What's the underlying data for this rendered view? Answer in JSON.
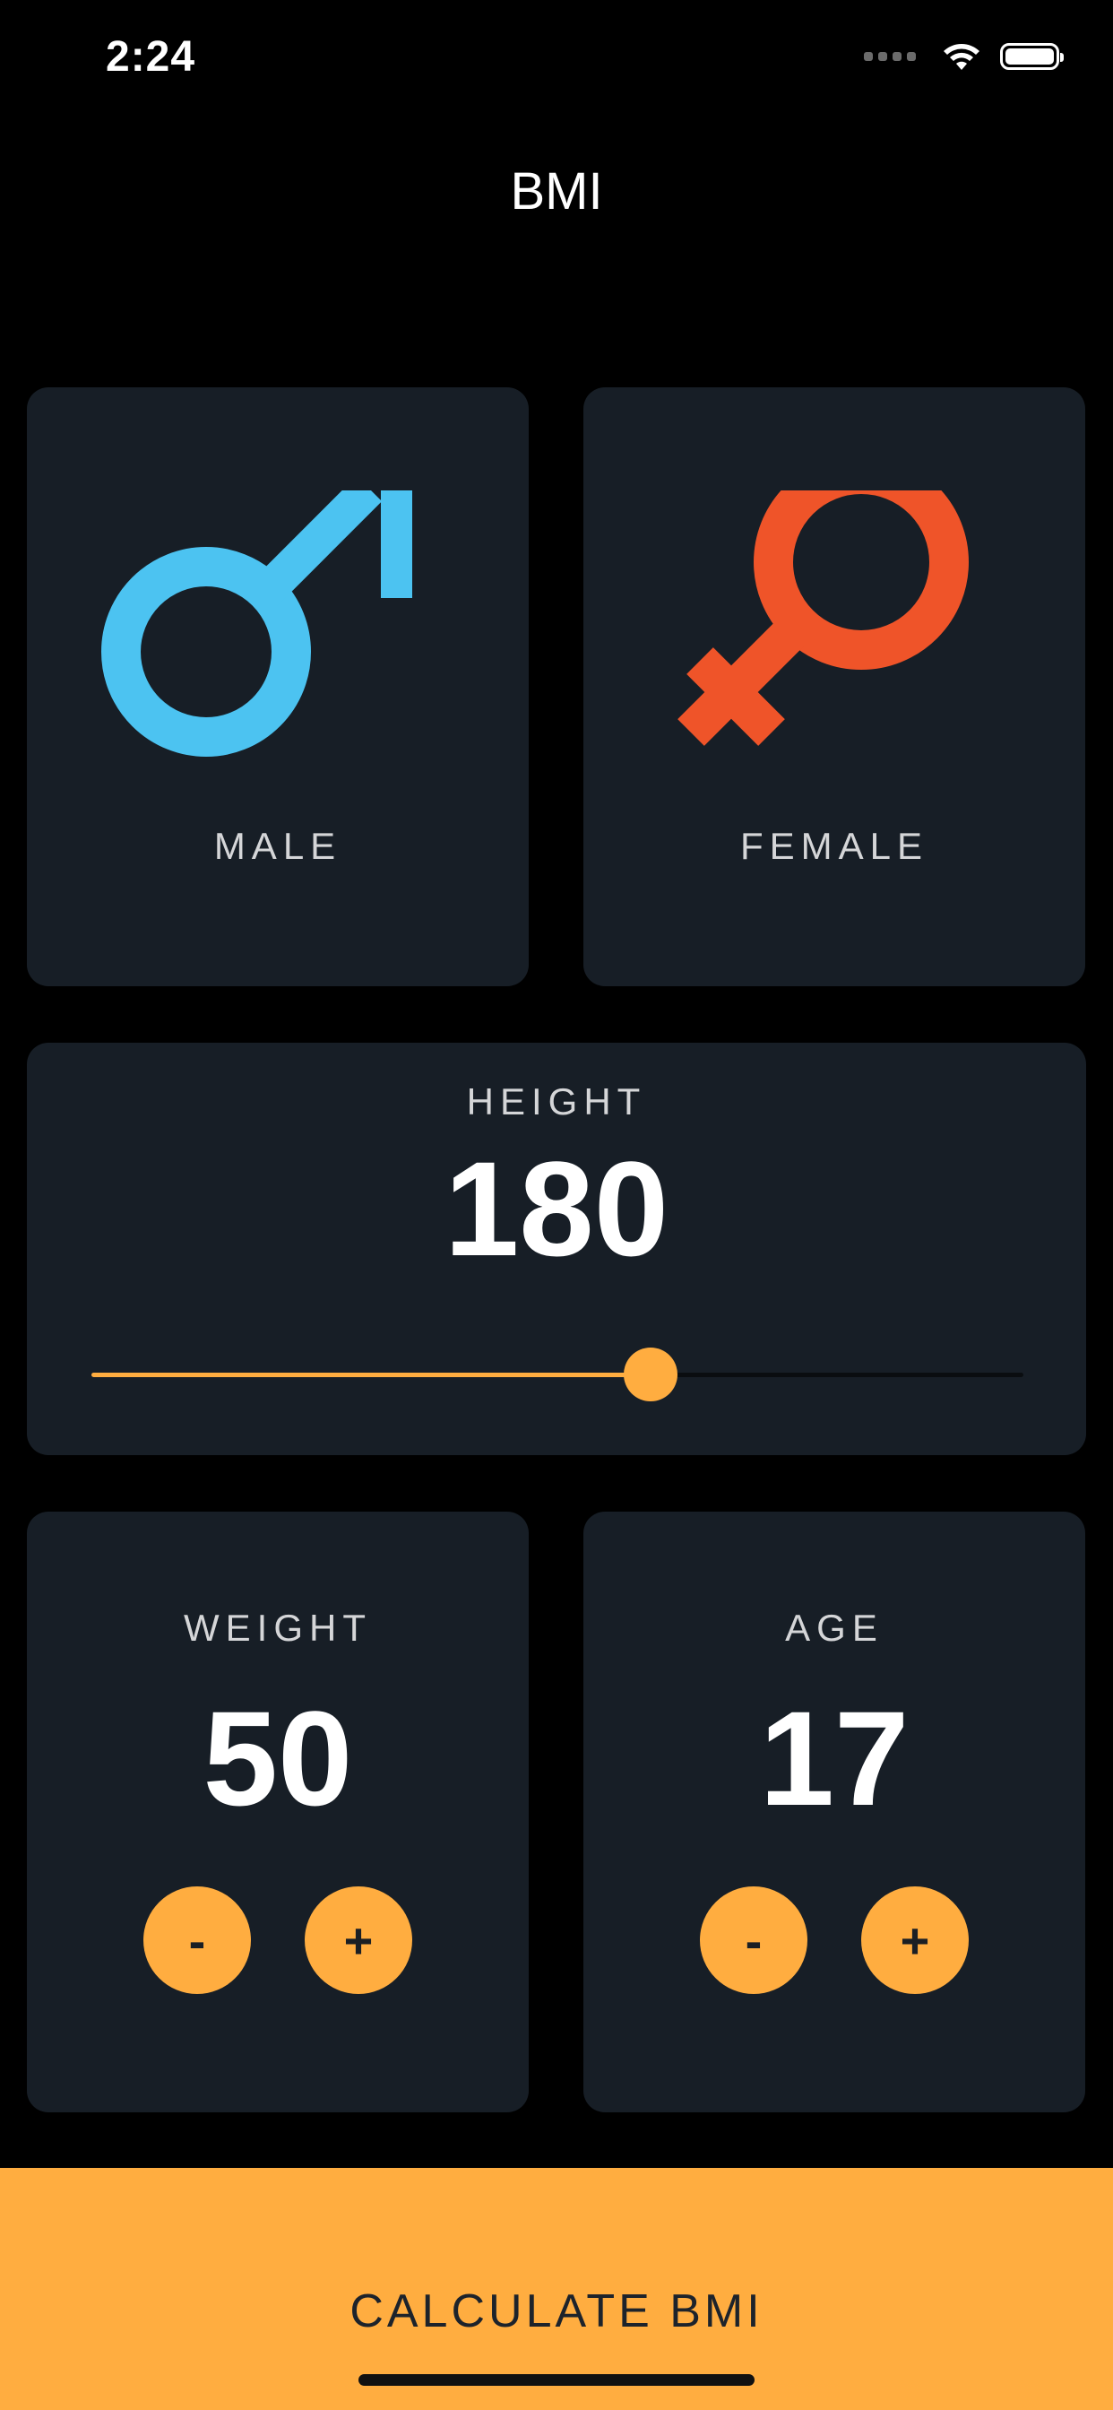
{
  "status_bar": {
    "time": "2:24",
    "icons": [
      "signal-icon",
      "wifi-icon",
      "battery-icon"
    ]
  },
  "app_title": "BMI",
  "gender": {
    "male": {
      "label": "MALE",
      "icon": "male-symbol-icon",
      "color": "#4cc3f1"
    },
    "female": {
      "label": "FEMALE",
      "icon": "female-symbol-icon",
      "color": "#ef5429"
    }
  },
  "height": {
    "label": "HEIGHT",
    "value": "180",
    "slider_fraction": 0.6
  },
  "weight": {
    "label": "WEIGHT",
    "value": "50",
    "minus_label": "-",
    "plus_label": "+"
  },
  "age": {
    "label": "AGE",
    "value": "17",
    "minus_label": "-",
    "plus_label": "+"
  },
  "calculate_button": {
    "label": "CALCULATE BMI"
  },
  "colors": {
    "background": "#000000",
    "card": "#171e26",
    "accent": "#ffad40",
    "label_text": "#d5d6d8"
  }
}
